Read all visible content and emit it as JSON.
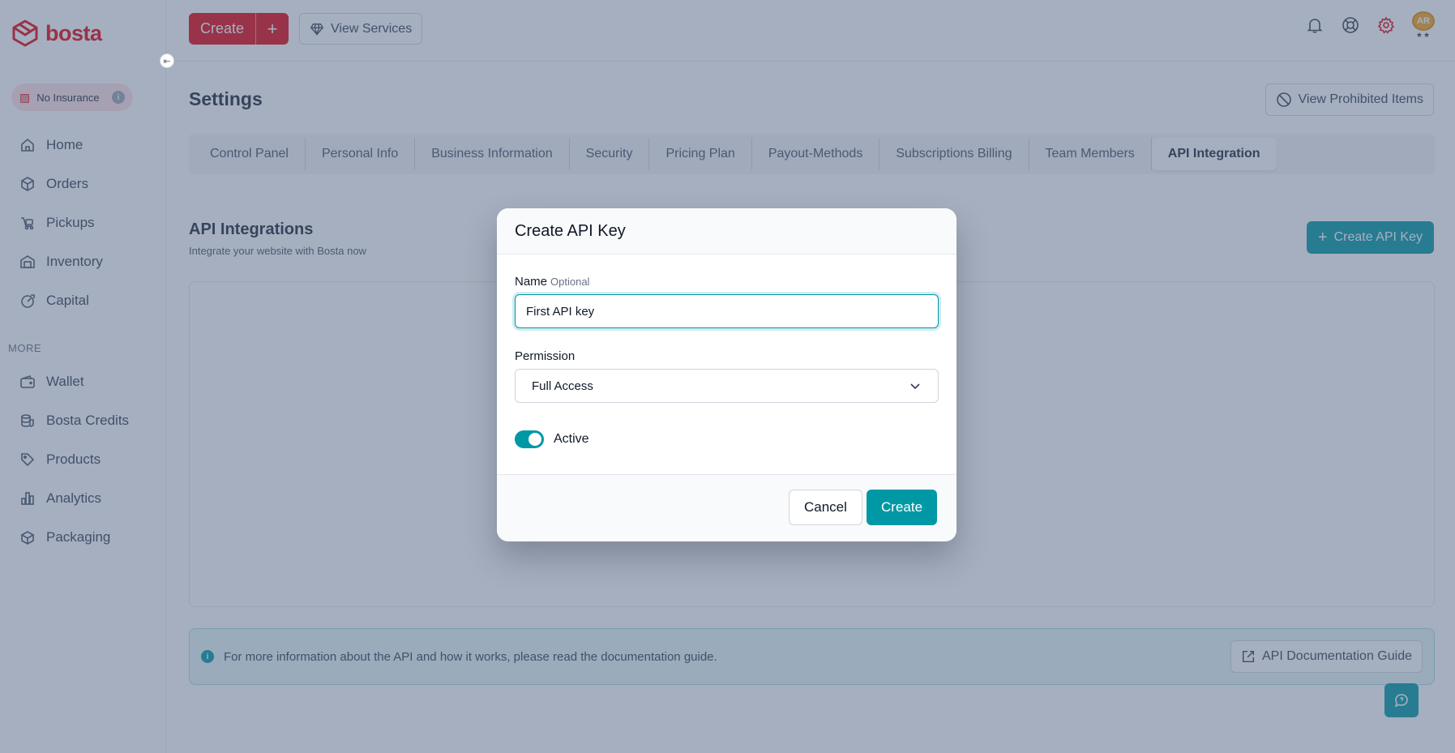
{
  "brand": {
    "name": "bosta",
    "primary_color": "#e30613",
    "accent_color": "#0098a5"
  },
  "sidebar": {
    "insurance_label": "No Insurance",
    "items": [
      {
        "label": "Home",
        "icon": "home-icon"
      },
      {
        "label": "Orders",
        "icon": "box-icon"
      },
      {
        "label": "Pickups",
        "icon": "truck-icon"
      },
      {
        "label": "Inventory",
        "icon": "warehouse-icon"
      },
      {
        "label": "Capital",
        "icon": "capital-icon"
      }
    ],
    "more_label": "MORE",
    "more_items": [
      {
        "label": "Wallet",
        "icon": "wallet-icon"
      },
      {
        "label": "Bosta Credits",
        "icon": "coins-icon"
      },
      {
        "label": "Products",
        "icon": "tag-icon"
      },
      {
        "label": "Analytics",
        "icon": "chart-icon"
      },
      {
        "label": "Packaging",
        "icon": "package-icon"
      }
    ]
  },
  "topbar": {
    "create_label": "Create",
    "create_plus": "+",
    "view_services_label": "View Services",
    "avatar_initials": "AR",
    "avatar_stars": "★★"
  },
  "page": {
    "title": "Settings",
    "prohibited_label": "View Prohibited Items",
    "tabs": [
      {
        "label": "Control Panel",
        "active": false
      },
      {
        "label": "Personal Info",
        "active": false
      },
      {
        "label": "Business Information",
        "active": false
      },
      {
        "label": "Security",
        "active": false
      },
      {
        "label": "Pricing Plan",
        "active": false
      },
      {
        "label": "Payout-Methods",
        "active": false
      },
      {
        "label": "Subscriptions Billing",
        "active": false
      },
      {
        "label": "Team Members",
        "active": false
      },
      {
        "label": "API Integration",
        "active": true
      }
    ],
    "section_title": "API Integrations",
    "section_subtitle": "Integrate your website with Bosta now",
    "create_api_key_label": "Create API Key",
    "doc_banner_text": "For more information about the API and how it works, please read the documentation guide.",
    "doc_guide_label": "API Documentation Guide"
  },
  "modal": {
    "title": "Create API Key",
    "name_label": "Name",
    "name_optional": "Optional",
    "name_value": "First API key",
    "permission_label": "Permission",
    "permission_value": "Full Access",
    "active_label": "Active",
    "active_on": true,
    "cancel_label": "Cancel",
    "create_label": "Create"
  }
}
